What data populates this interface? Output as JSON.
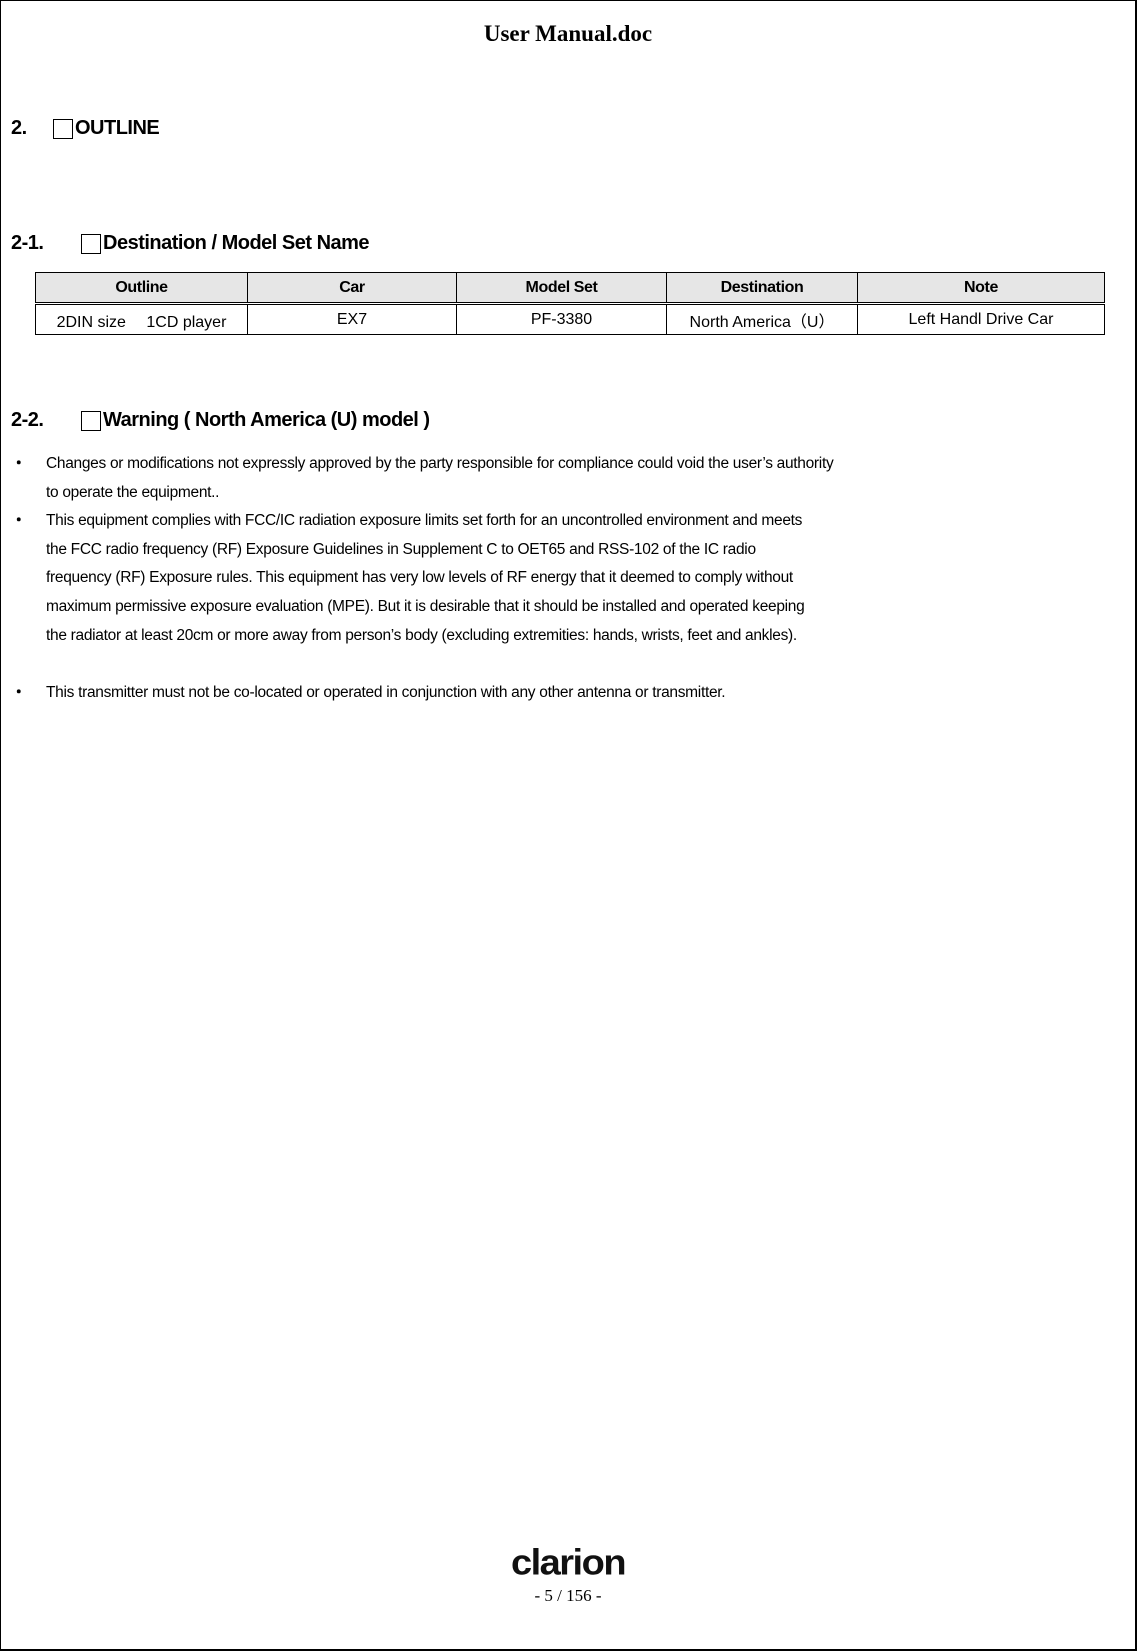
{
  "document": {
    "header_title": "User Manual.doc",
    "logo_text": "clarion",
    "page_number": "- 5 / 156 -"
  },
  "sections": {
    "outline": {
      "number": "2.",
      "title": "OUTLINE"
    },
    "destination": {
      "number": "2-1.",
      "title": "Destination / Model Set Name"
    },
    "warning": {
      "number": "2-2.",
      "title": "Warning ( North America (U) model )"
    }
  },
  "table": {
    "headers": [
      "Outline",
      "Car",
      "Model Set",
      "Destination",
      "Note"
    ],
    "rows": [
      [
        "2DIN size　 1CD player",
        "EX7",
        "PF-3380",
        "North America（U）",
        "Left Handl Drive Car"
      ]
    ]
  },
  "warnings": {
    "bullet_glyph": "・",
    "items": [
      {
        "lines": [
          "Changes or modifications not expressly approved by the party responsible for compliance could void the user’s authority",
          "to operate the equipment.."
        ]
      },
      {
        "lines": [
          "This equipment complies with FCC/IC radiation exposure limits set forth for an uncontrolled environment and meets",
          "the FCC radio frequency (RF) Exposure Guidelines in Supplement C to OET65 and RSS-102 of the IC radio",
          "frequency (RF) Exposure rules. This equipment has very low levels of RF energy that it deemed to comply without",
          "maximum permissive exposure evaluation (MPE). But it is desirable that it should be installed and operated keeping",
          "the radiator at least 20cm or more away from person’s body (excluding extremities: hands, wrists, feet and ankles)."
        ]
      },
      {
        "lines": [
          "This transmitter must not be co-located or operated in conjunction with any other antenna or transmitter."
        ]
      }
    ]
  }
}
